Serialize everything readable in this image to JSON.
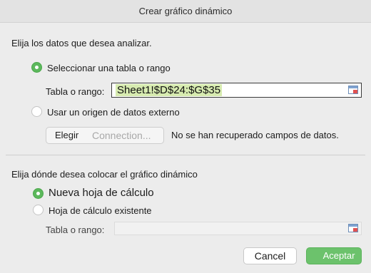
{
  "window": {
    "title": "Crear gráfico dinámico"
  },
  "source": {
    "heading": "Elija los datos que desea analizar.",
    "option_table": "Seleccionar una tabla o rango",
    "range_label": "Tabla o rango:",
    "range_value": "Sheet1!$D$24:$G$35",
    "option_external": "Usar un origen de datos externo",
    "choose_button": "Elegir",
    "connection_label": "Connection...",
    "status": "No se han recuperado campos de datos."
  },
  "destination": {
    "heading": "Elija dónde desea colocar el gráfico dinámico",
    "option_new_sheet": "Nueva hoja de cálculo",
    "option_existing_sheet": "Hoja de cálculo existente",
    "range_label": "Tabla o rango:",
    "range_value": ""
  },
  "footer": {
    "cancel_label": "Cancel",
    "accept_label": "Aceptar"
  },
  "colors": {
    "accent": "#5cb85c",
    "selection_highlight": "#d7ebb0"
  },
  "icons": {
    "range_picker": "range-picker-icon"
  }
}
